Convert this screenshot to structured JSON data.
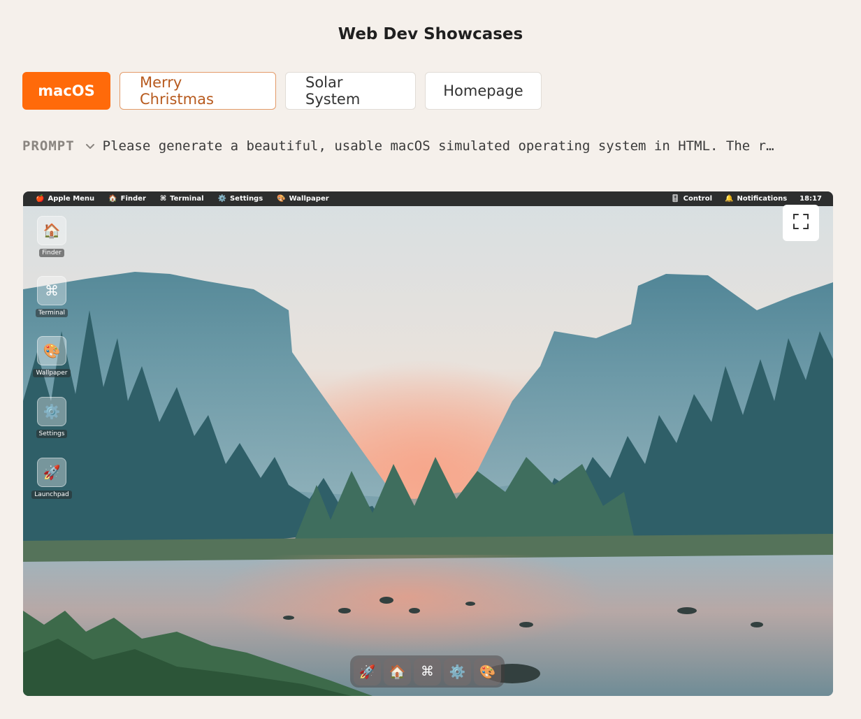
{
  "header": {
    "title": "Web Dev Showcases"
  },
  "tabs": [
    {
      "label": "macOS",
      "state": "active"
    },
    {
      "label": "Merry Christmas",
      "state": "hover"
    },
    {
      "label": "Solar System",
      "state": "default"
    },
    {
      "label": "Homepage",
      "state": "default"
    }
  ],
  "prompt": {
    "label": "PROMPT",
    "text": "Please generate a beautiful, usable macOS simulated operating system in HTML. The r…"
  },
  "desktop": {
    "menubar": {
      "left": [
        {
          "icon": "🍎",
          "label": "Apple Menu"
        },
        {
          "icon": "🏠",
          "label": "Finder"
        },
        {
          "icon": "⌘",
          "label": "Terminal"
        },
        {
          "icon": "⚙️",
          "label": "Settings"
        },
        {
          "icon": "🎨",
          "label": "Wallpaper"
        }
      ],
      "right": [
        {
          "icon": "🎚️",
          "label": "Control"
        },
        {
          "icon": "🔔",
          "label": "Notifications"
        }
      ],
      "clock": "18:17"
    },
    "desktop_icons": [
      {
        "icon": "🏠",
        "label": "Finder"
      },
      {
        "icon": "⌘",
        "label": "Terminal"
      },
      {
        "icon": "🎨",
        "label": "Wallpaper"
      },
      {
        "icon": "⚙️",
        "label": "Settings"
      },
      {
        "icon": "🚀",
        "label": "Launchpad"
      }
    ],
    "dock": [
      {
        "icon": "🚀",
        "name": "launchpad"
      },
      {
        "icon": "🏠",
        "name": "finder"
      },
      {
        "icon": "⌘",
        "name": "terminal"
      },
      {
        "icon": "⚙️",
        "name": "settings"
      },
      {
        "icon": "🎨",
        "name": "wallpaper"
      }
    ]
  },
  "colors": {
    "accent": "#ff6a0a",
    "background": "#f5f0eb",
    "hover_text": "#b75a1e"
  }
}
